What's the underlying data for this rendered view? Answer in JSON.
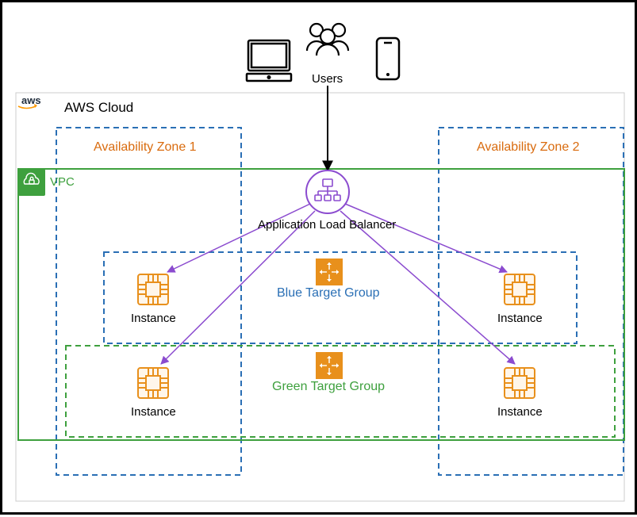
{
  "users_label": "Users",
  "cloud_label": "AWS Cloud",
  "vpc_label": "VPC",
  "az1_label": "Availability Zone 1",
  "az2_label": "Availability Zone 2",
  "alb_label": "Application Load Balancer",
  "blue_group_label": "Blue Target Group",
  "green_group_label": "Green Target Group",
  "instance_label_tl": "Instance",
  "instance_label_tr": "Instance",
  "instance_label_bl": "Instance",
  "instance_label_br": "Instance",
  "colors": {
    "az_border": "#2a6fb5",
    "vpc_border": "#3ea03e",
    "cloud_border": "#cccccc",
    "alb_color": "#8b4bcf",
    "instance_color": "#e8901c",
    "target_group_fill": "#e8901c"
  }
}
